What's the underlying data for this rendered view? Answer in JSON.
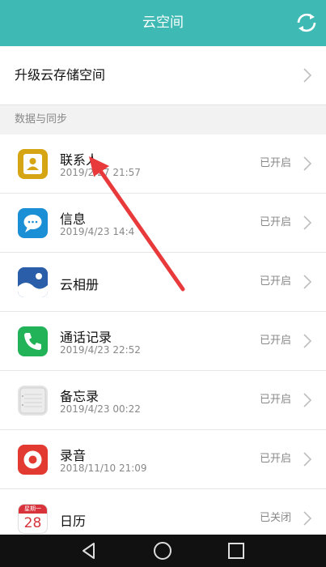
{
  "header": {
    "title": "云空间",
    "sync_icon": "sync-icon"
  },
  "upgrade": {
    "label": "升级云存储空间"
  },
  "section": {
    "title": "数据与同步"
  },
  "items": [
    {
      "key": "contacts",
      "name": "联系人",
      "date": "2019/2/27 21:57",
      "status": "已开启",
      "icon": "contacts-icon"
    },
    {
      "key": "messages",
      "name": "信息",
      "date": "2019/4/23 14:4",
      "status": "已开启",
      "icon": "messages-icon"
    },
    {
      "key": "gallery",
      "name": "云相册",
      "date": "",
      "status": "已开启",
      "icon": "gallery-icon"
    },
    {
      "key": "calllog",
      "name": "通话记录",
      "date": "2019/4/23 22:52",
      "status": "已开启",
      "icon": "phone-icon"
    },
    {
      "key": "notes",
      "name": "备忘录",
      "date": "2019/4/23 00:22",
      "status": "已开启",
      "icon": "notes-icon"
    },
    {
      "key": "recorder",
      "name": "录音",
      "date": "2018/11/10 21:09",
      "status": "已开启",
      "icon": "recorder-icon"
    },
    {
      "key": "calendar",
      "name": "日历",
      "date": "",
      "status": "已关闭",
      "icon": "calendar-icon",
      "icon_text_top": "星期一",
      "icon_text_day": "28"
    }
  ],
  "colors": {
    "header": "#3fb9b3",
    "annotation_arrow": "#e8393b"
  }
}
